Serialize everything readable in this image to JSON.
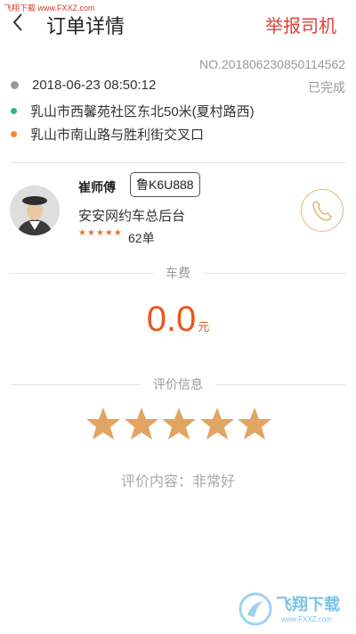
{
  "watermark_top": "飞翔下载 www.FXXZ.com",
  "header": {
    "title": "订单详情",
    "report": "举报司机"
  },
  "order": {
    "number": "NO.20180623085011456​2",
    "time": "2018-06-23 08:50:12",
    "status": "已完成",
    "start": "乳山市西馨苑社区东北50米(夏村路西)",
    "end": "乳山市南山路与胜利街交叉口"
  },
  "driver": {
    "name": "崔师傅",
    "plate": "鲁K6U888",
    "company": "安安网约车总后台",
    "rating_stars": 5,
    "orders": "62单"
  },
  "fare": {
    "section": "车费",
    "amount": "0.0",
    "unit": "元"
  },
  "rating": {
    "section": "评价信息",
    "stars": 5,
    "comment": "评价内容：非常好"
  },
  "watermark_bottom": {
    "text": "飞翔下载",
    "url": "www.FXXZ.com"
  },
  "colors": {
    "accent": "#e0403a",
    "fare": "#e8591c",
    "star": "#e2a462",
    "start_dot": "#2bb58a",
    "end_dot": "#f08a3a"
  }
}
